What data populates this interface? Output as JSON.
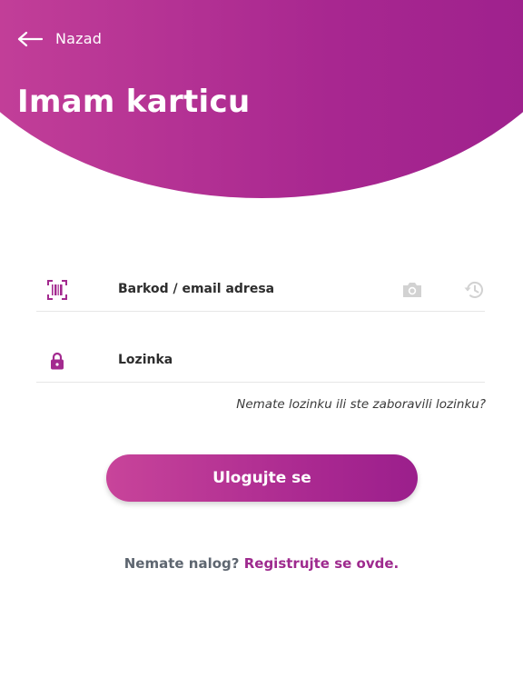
{
  "header": {
    "back_label": "Nazad",
    "title": "Imam karticu"
  },
  "form": {
    "barcode_placeholder": "Barkod / email adresa",
    "password_placeholder": "Lozinka",
    "forgot_link": "Nemate lozinku ili ste zaboravili lozinku?",
    "login_button": "Ulogujte se"
  },
  "footer": {
    "question": "Nemate nalog?",
    "register_link": "Registrujte se ovde."
  },
  "icons": {
    "back": "arrow-left-icon",
    "barcode": "barcode-scan-icon",
    "camera": "camera-icon",
    "history": "history-icon",
    "lock": "lock-icon"
  },
  "colors": {
    "brand_start": "#c8449a",
    "brand_end": "#9b1f8c",
    "muted_icon": "#d2d2d2",
    "link_text": "#9e2a8e"
  }
}
